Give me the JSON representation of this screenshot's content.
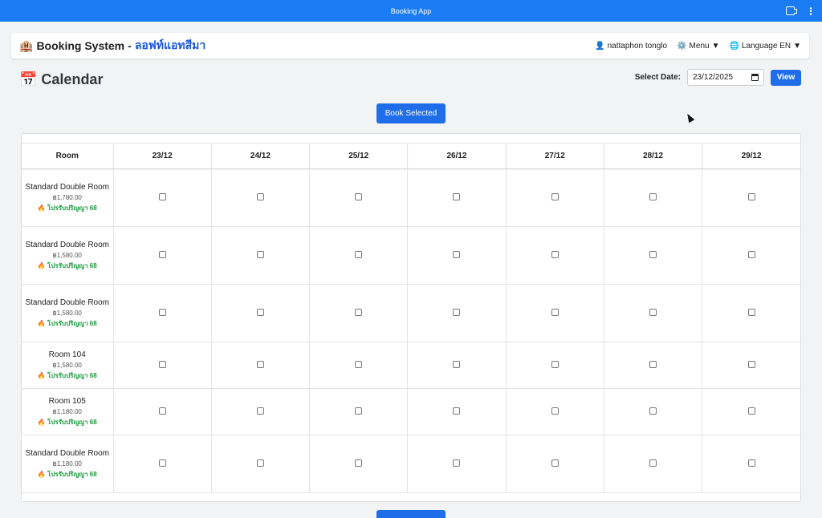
{
  "window": {
    "title": "Booking App"
  },
  "navbar": {
    "brand_icon": "🏨",
    "brand": "Booking System",
    "separator": "-",
    "branch": "ลอฟท์แอทสีมา",
    "user_icon": "👤",
    "user": "nattaphon tonglo",
    "menu_icon": "⚙️",
    "menu": "Menu",
    "language_icon": "🌐",
    "language": "Language EN",
    "caret": "▼"
  },
  "page": {
    "title_icon": "📅",
    "title": "Calendar",
    "select_date_label": "Select Date:",
    "date_value": "23/12/2025",
    "view_label": "View",
    "book_selected_label": "Book Selected"
  },
  "table": {
    "room_header": "Room",
    "dates": [
      "23/12",
      "24/12",
      "25/12",
      "26/12",
      "27/12",
      "28/12",
      "29/12"
    ],
    "rows": [
      {
        "name": "Standard Double Room",
        "price": "฿1,780.00",
        "promo_icon": "🔥",
        "promo": "โปรรับปริญญา 68"
      },
      {
        "name": "Standard Double Room",
        "price": "฿1,580.00",
        "promo_icon": "🔥",
        "promo": "โปรรับปริญญา 68"
      },
      {
        "name": "Standard Double Room",
        "price": "฿1,580.00",
        "promo_icon": "🔥",
        "promo": "โปรรับปริญญา 68"
      },
      {
        "name": "Room 104",
        "price": "฿1,580.00",
        "promo_icon": "🔥",
        "promo": "โปรรับปริญญา 68"
      },
      {
        "name": "Room 105",
        "price": "฿1,180.00",
        "promo_icon": "🔥",
        "promo": "โปรรับปริญญา 68"
      },
      {
        "name": "Standard Double Room",
        "price": "฿1,180.00",
        "promo_icon": "🔥",
        "promo": "โปรรับปริญญา 68"
      }
    ]
  },
  "colors": {
    "titlebar": "#1a7cf5",
    "primary_button": "#1f6de8",
    "promo": "#1a9b3c",
    "branch": "#1a56db"
  }
}
